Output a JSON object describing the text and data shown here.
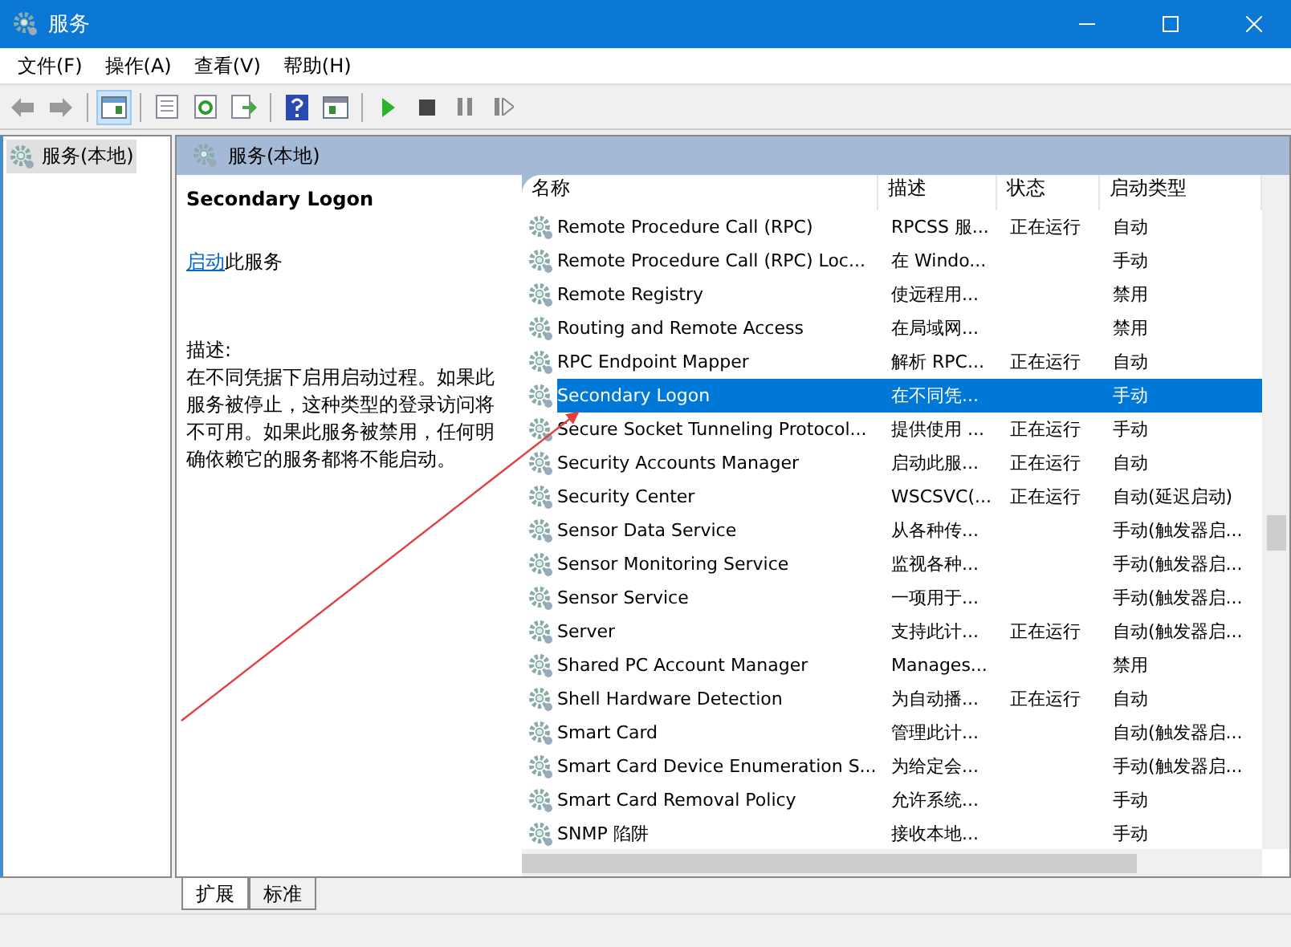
{
  "window": {
    "title": "服务"
  },
  "menu": [
    "文件(F)",
    "操作(A)",
    "查看(V)",
    "帮助(H)"
  ],
  "toolbar": [
    {
      "kind": "back",
      "selected": false
    },
    {
      "kind": "forward",
      "selected": false
    },
    {
      "kind": "sep"
    },
    {
      "kind": "tree",
      "selected": true
    },
    {
      "kind": "sep"
    },
    {
      "kind": "properties",
      "selected": false
    },
    {
      "kind": "refresh",
      "selected": false
    },
    {
      "kind": "export",
      "selected": false
    },
    {
      "kind": "sep"
    },
    {
      "kind": "help",
      "selected": false
    },
    {
      "kind": "view",
      "selected": false
    },
    {
      "kind": "sep"
    },
    {
      "kind": "play",
      "selected": false
    },
    {
      "kind": "stop",
      "selected": false
    },
    {
      "kind": "pause",
      "selected": false
    },
    {
      "kind": "resume",
      "selected": false
    }
  ],
  "tree": {
    "items": [
      {
        "label": "服务(本地)",
        "selected": true
      }
    ]
  },
  "panel": {
    "title": "服务(本地)"
  },
  "details": {
    "service_name": "Secondary Logon",
    "action_link": "启动",
    "action_text": "此服务",
    "description_label": "描述:",
    "description": "在不同凭据下启用启动过程。如果此服务被停止，这种类型的登录访问将不可用。如果此服务被禁用，任何明确依赖它的服务都将不能启动。"
  },
  "table": {
    "columns": [
      "名称",
      "描述",
      "状态",
      "启动类型"
    ],
    "rows": [
      {
        "name": "Remote Procedure Call (RPC)",
        "description": "RPCSS 服...",
        "status": "正在运行",
        "startup": "自动",
        "selected": false
      },
      {
        "name": "Remote Procedure Call (RPC) Loc...",
        "description": "在 Windo...",
        "status": "",
        "startup": "手动",
        "selected": false
      },
      {
        "name": "Remote Registry",
        "description": "使远程用...",
        "status": "",
        "startup": "禁用",
        "selected": false
      },
      {
        "name": "Routing and Remote Access",
        "description": "在局域网...",
        "status": "",
        "startup": "禁用",
        "selected": false
      },
      {
        "name": "RPC Endpoint Mapper",
        "description": "解析 RPC...",
        "status": "正在运行",
        "startup": "自动",
        "selected": false
      },
      {
        "name": "Secondary Logon",
        "description": "在不同凭...",
        "status": "",
        "startup": "手动",
        "selected": true
      },
      {
        "name": "Secure Socket Tunneling Protocol...",
        "description": "提供使用 ...",
        "status": "正在运行",
        "startup": "手动",
        "selected": false
      },
      {
        "name": "Security Accounts Manager",
        "description": "启动此服...",
        "status": "正在运行",
        "startup": "自动",
        "selected": false
      },
      {
        "name": "Security Center",
        "description": "WSCSVC(...",
        "status": "正在运行",
        "startup": "自动(延迟启动)",
        "selected": false
      },
      {
        "name": "Sensor Data Service",
        "description": "从各种传...",
        "status": "",
        "startup": "手动(触发器启...",
        "selected": false
      },
      {
        "name": "Sensor Monitoring Service",
        "description": "监视各种...",
        "status": "",
        "startup": "手动(触发器启...",
        "selected": false
      },
      {
        "name": "Sensor Service",
        "description": "一项用于...",
        "status": "",
        "startup": "手动(触发器启...",
        "selected": false
      },
      {
        "name": "Server",
        "description": "支持此计...",
        "status": "正在运行",
        "startup": "自动(触发器启...",
        "selected": false
      },
      {
        "name": "Shared PC Account Manager",
        "description": "Manages...",
        "status": "",
        "startup": "禁用",
        "selected": false
      },
      {
        "name": "Shell Hardware Detection",
        "description": "为自动播...",
        "status": "正在运行",
        "startup": "自动",
        "selected": false
      },
      {
        "name": "Smart Card",
        "description": "管理此计...",
        "status": "",
        "startup": "自动(触发器启...",
        "selected": false
      },
      {
        "name": "Smart Card Device Enumeration S...",
        "description": "为给定会...",
        "status": "",
        "startup": "手动(触发器启...",
        "selected": false
      },
      {
        "name": "Smart Card Removal Policy",
        "description": "允许系统...",
        "status": "",
        "startup": "手动",
        "selected": false
      },
      {
        "name": "SNMP 陷阱",
        "description": "接收本地...",
        "status": "",
        "startup": "手动",
        "selected": false
      }
    ]
  },
  "bottom_tabs": [
    {
      "label": "扩展",
      "selected": true
    },
    {
      "label": "标准",
      "selected": false
    }
  ]
}
